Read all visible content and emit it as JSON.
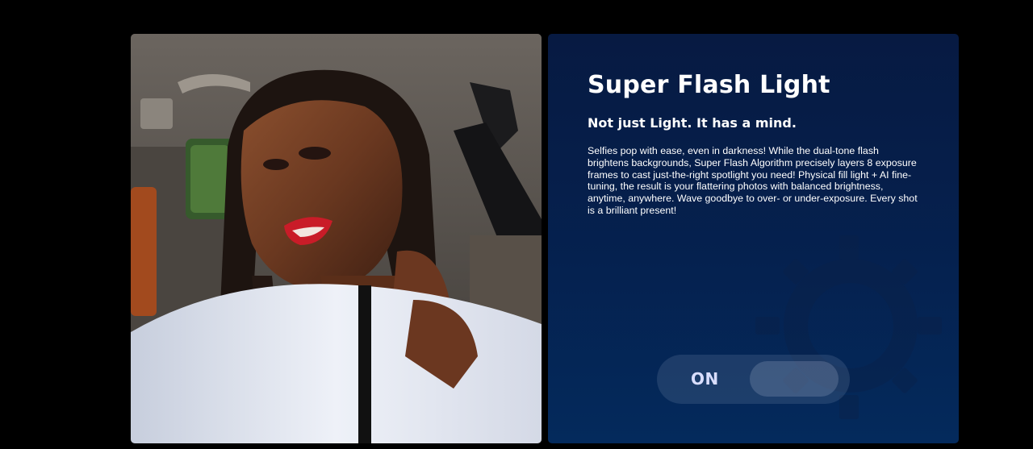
{
  "feature": {
    "title": "Super Flash Light",
    "subtitle": "Not just Light. It has a mind.",
    "description": "Selfies pop with ease, even in darkness! While the dual-tone flash brightens backgrounds, Super Flash Algorithm precisely layers 8 exposure frames to cast just-the-right spotlight you need! Physical fill light + AI fine-tuning, the result is your flattering photos with balanced brightness, anytime, anywhere. Wave goodbye to over- or under-exposure. Every shot is a brilliant present!"
  },
  "toggle": {
    "label": "ON",
    "state": "on"
  },
  "images": {
    "photo": "selfie-portrait-in-car",
    "background_icon": "sun-icon"
  },
  "colors": {
    "page_background": "#000000",
    "card_background": "#05214f",
    "text": "#ffffff",
    "toggle_label": "#d9defe"
  }
}
